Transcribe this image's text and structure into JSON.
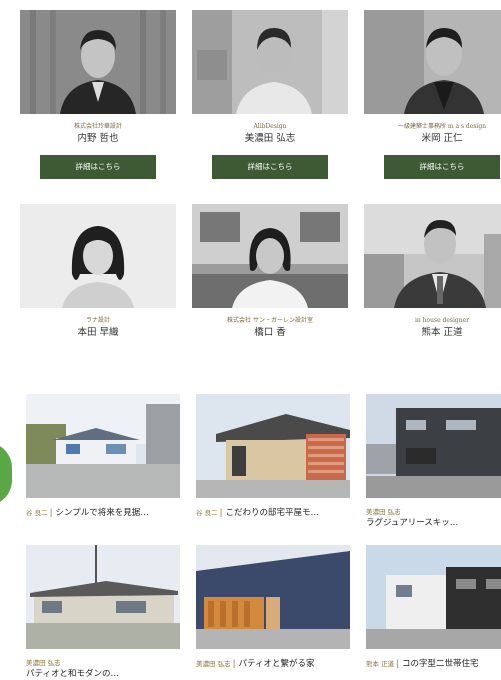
{
  "designers": [
    {
      "firm": "株式会社玲華設計",
      "name": "内野 哲也",
      "button": "詳細はこちら"
    },
    {
      "firm": "AlibDesign",
      "name": "美濃田 弘志",
      "button": "詳細はこちら"
    },
    {
      "firm": "一級建築士事務所 m a s design",
      "name": "米岡 正仁",
      "button": "詳細はこちら"
    },
    {
      "firm": "ラナ設計",
      "name": "本田 早織"
    },
    {
      "firm": "株式会社 サン・ガーレン設計室",
      "name": "橋口 香"
    },
    {
      "firm": "in house designer",
      "name": "熊本 正道"
    }
  ],
  "works": [
    {
      "author": "谷 良二",
      "title": "シンプルで将来を見据…"
    },
    {
      "author": "谷 良二",
      "title": "こだわりの邸宅平屋モ…"
    },
    {
      "author": "美濃田 弘志",
      "title": "ラグジュアリースキッ…"
    },
    {
      "author": "美濃田 弘志",
      "title": "パティオと和モダンの…"
    },
    {
      "author": "美濃田 弘志",
      "title": "パティオと繋がる家"
    },
    {
      "author": "熊本 正道",
      "title": "コの字型二世帯住宅"
    }
  ]
}
